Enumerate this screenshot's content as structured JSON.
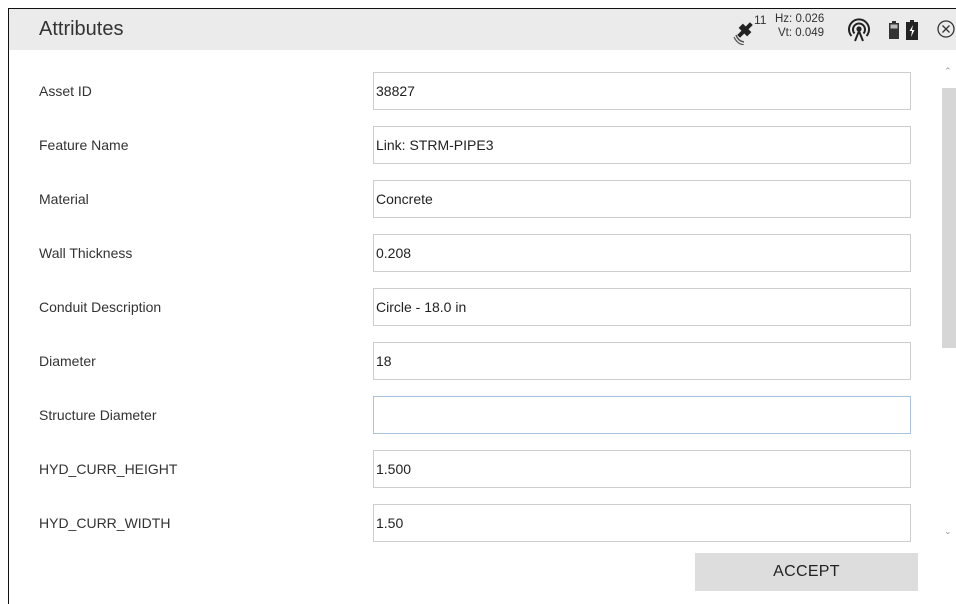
{
  "header": {
    "title": "Attributes",
    "satellite_count": "11",
    "hz": "Hz: 0.026",
    "vt": "Vt: 0.049"
  },
  "fields": [
    {
      "label": "Asset ID",
      "value": "38827"
    },
    {
      "label": "Feature Name",
      "value": "Link: STRM-PIPE3"
    },
    {
      "label": "Material",
      "value": "Concrete"
    },
    {
      "label": "Wall Thickness",
      "value": "0.208"
    },
    {
      "label": "Conduit Description",
      "value": "Circle - 18.0 in"
    },
    {
      "label": "Diameter",
      "value": "18"
    },
    {
      "label": "Structure Diameter",
      "value": ""
    },
    {
      "label": "HYD_CURR_HEIGHT",
      "value": "1.500"
    },
    {
      "label": "HYD_CURR_WIDTH",
      "value": "1.50"
    }
  ],
  "footer": {
    "accept_label": "ACCEPT"
  },
  "icons": {
    "satellite": "satellite-icon",
    "radio": "radio-signal-icon",
    "battery1": "battery-icon",
    "battery2": "battery-charging-icon",
    "close": "close-icon"
  }
}
